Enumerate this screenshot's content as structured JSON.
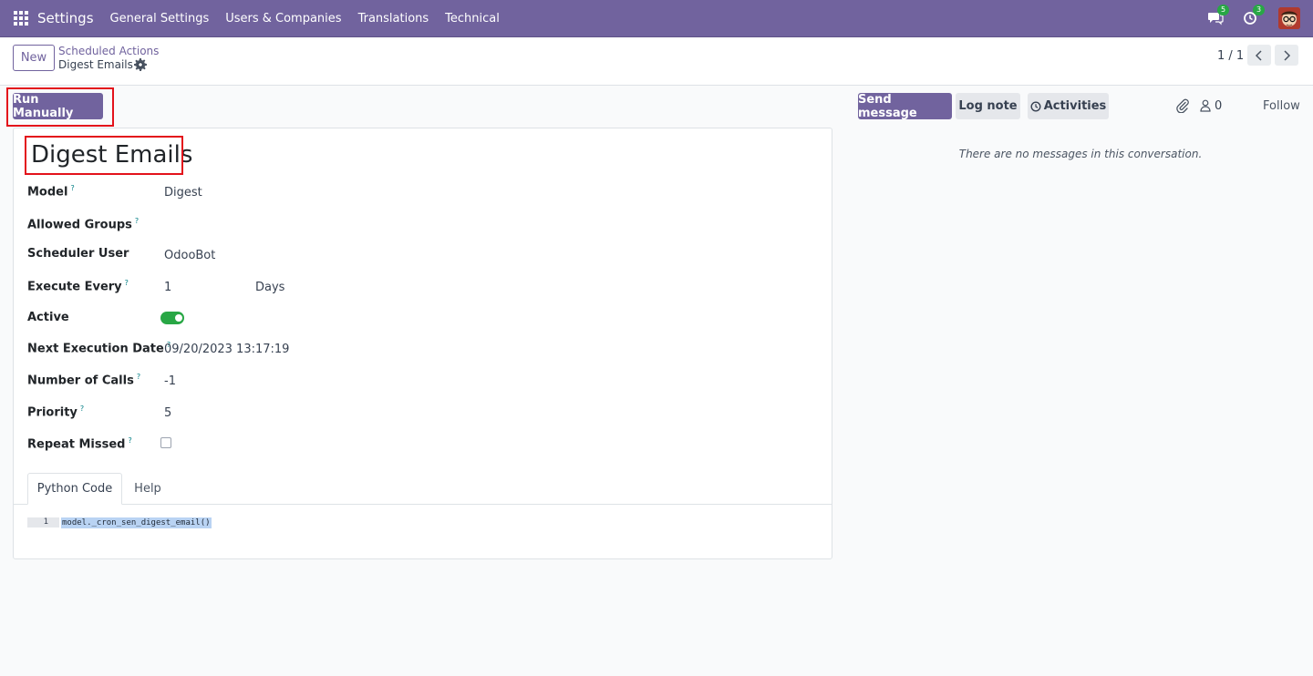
{
  "navbar": {
    "app_name": "Settings",
    "menu": [
      "General Settings",
      "Users & Companies",
      "Translations",
      "Technical"
    ],
    "messages_badge": "5",
    "activities_badge": "3",
    "bg_color": "#71639e"
  },
  "control_panel": {
    "new_label": "New",
    "breadcrumb_parent": "Scheduled Actions",
    "breadcrumb_current": "Digest Emails",
    "pager": "1 / 1"
  },
  "statusbar": {
    "run_label": "Run Manually"
  },
  "form": {
    "title": "Digest Emails",
    "help_mark": "?",
    "fields": {
      "model": {
        "label": "Model",
        "value": "Digest"
      },
      "allowed_groups": {
        "label": "Allowed Groups",
        "value": ""
      },
      "scheduler_user": {
        "label": "Scheduler User",
        "value": "OdooBot"
      },
      "execute_every": {
        "label": "Execute Every",
        "value": "1",
        "unit": "Days"
      },
      "active": {
        "label": "Active",
        "value": true
      },
      "next_execution": {
        "label": "Next Execution Date",
        "value": "09/20/2023 13:17:19"
      },
      "number_of_calls": {
        "label": "Number of Calls",
        "value": "-1"
      },
      "priority": {
        "label": "Priority",
        "value": "5"
      },
      "repeat_missed": {
        "label": "Repeat Missed",
        "value": false
      }
    },
    "tabs": [
      "Python Code",
      "Help"
    ],
    "code": {
      "line_number": "1",
      "line": "model._cron_sen_digest_email()"
    }
  },
  "chatter": {
    "send_message": "Send message",
    "log_note": "Log note",
    "activities": "Activities",
    "followers_count": "0",
    "follow": "Follow",
    "empty_text": "There are no messages in this conversation."
  },
  "colors": {
    "primary": "#71639e",
    "highlight": "#e3121b",
    "success": "#28a745"
  }
}
